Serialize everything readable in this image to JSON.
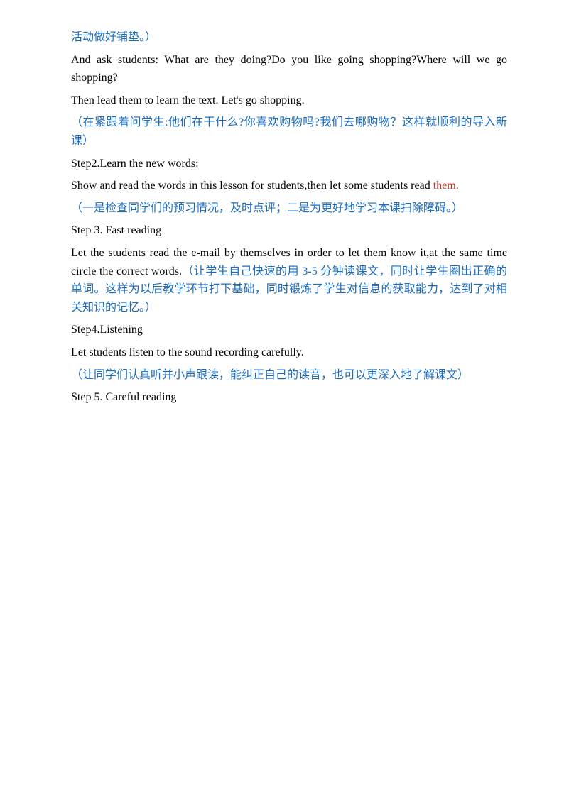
{
  "page": {
    "blocks": [
      {
        "id": "block1",
        "type": "zh",
        "text": "活动做好铺垫。）"
      },
      {
        "id": "block2",
        "type": "en",
        "text": "And ask students: What are they doing?Do you like going shopping?Where will we go shopping?"
      },
      {
        "id": "block3",
        "type": "en",
        "text": "Then lead them to learn the text. Let's go shopping."
      },
      {
        "id": "block4",
        "type": "zh",
        "text": "（在紧跟着问学生:他们在干什么?你喜欢购物吗?我们去哪购物？这样就顺利的导入新课）"
      },
      {
        "id": "block5",
        "type": "en",
        "text": "Step2.Learn the new words:"
      },
      {
        "id": "block6",
        "type": "en_with_highlight",
        "text_before": "Show and read the words in this lesson for students,then let some students read ",
        "text_highlight": "them.",
        "text_after": ""
      },
      {
        "id": "block7",
        "type": "zh",
        "text": "（一是检查同学们的预习情况，及时点评；二是为更好地学习本课扫除障碍。）"
      },
      {
        "id": "block8",
        "type": "en",
        "text": "Step 3. Fast reading"
      },
      {
        "id": "block9",
        "type": "en_zh_mixed",
        "text_en_before": "Let the students read the e-mail by themselves in order to let them know it,at the same time circle the correct words.",
        "text_zh": "（让学生自己快速的用 3-5 分钟读课文，同时让学生圈出正确的单词。这样为以后教学环节打下基础，同时锻炼了学生对信息的获取能力，达到了对相关知识的记忆。）"
      },
      {
        "id": "block10",
        "type": "en",
        "text": "Step4.Listening"
      },
      {
        "id": "block11",
        "type": "en",
        "text": "Let students listen to the sound recording carefully."
      },
      {
        "id": "block12",
        "type": "zh",
        "text": "（让同学们认真听并小声跟读，能纠正自己的读音，也可以更深入地了解课文）"
      },
      {
        "id": "block13",
        "type": "en",
        "text": "Step 5. Careful reading"
      }
    ]
  }
}
